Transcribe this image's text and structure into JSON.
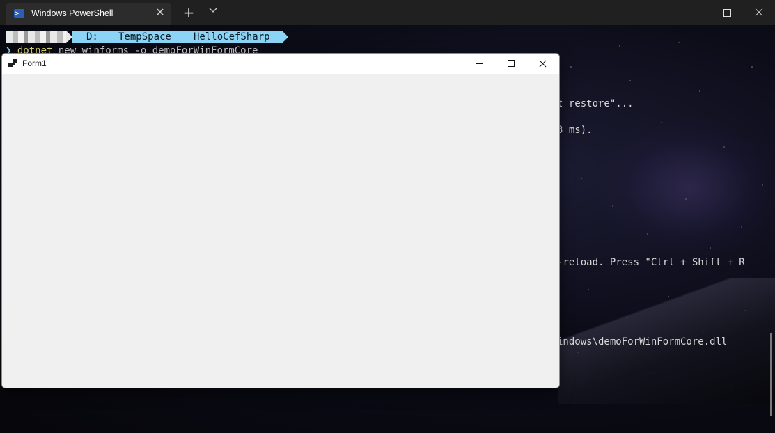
{
  "terminal": {
    "tab_title": "Windows PowerShell",
    "tab_icon": "powershell-icon",
    "new_tab_symbol": "+",
    "dropdown_symbol": "⌄",
    "close_symbol": "✕"
  },
  "prompt": {
    "drive": "D:",
    "folder1": "TempSpace",
    "folder2": "HelloCefSharp",
    "prompt_arrow": "❯",
    "command_name": "dotnet",
    "command_args": " new winforms -o demoForWinFormCore"
  },
  "output": {
    "line1": "t restore\"...",
    "line2": "3 ms).",
    "line3": "-reload. Press \"Ctrl + Shift + R",
    "line4": "indows\\demoForWinFormCore.dll"
  },
  "form": {
    "title": "Form1"
  },
  "colors": {
    "tab_bar": "#202020",
    "active_tab": "#2c2c2c",
    "path_segment": "#8bd4f5",
    "command_highlight": "#e5e07a",
    "form_background": "#f0f0f0"
  }
}
